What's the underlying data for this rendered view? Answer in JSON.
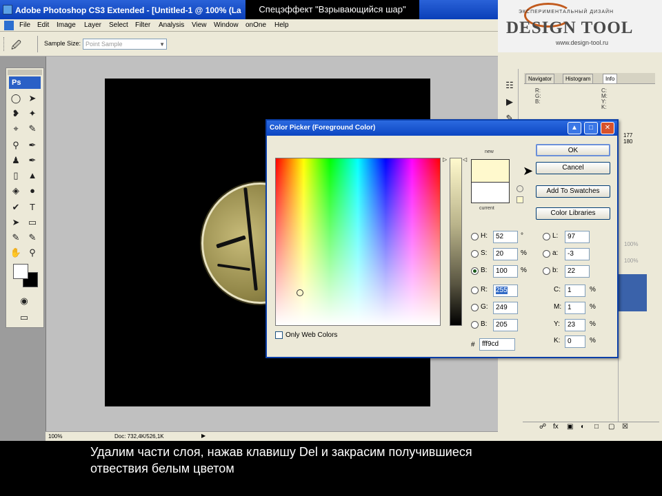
{
  "window": {
    "title": "Adobe Photoshop CS3 Extended - [Untitled-1 @ 100% (La",
    "banner": "Спецэффект \"Взрывающийся шар\""
  },
  "logo": {
    "tagline": "ЭКСПЕРИМЕНТАЛЬНЫЙ ДИЗАЙН",
    "brand": "DESIGN TOOL",
    "url": "www.design-tool.ru"
  },
  "menu": {
    "items": [
      "File",
      "Edit",
      "Image",
      "Layer",
      "Select",
      "Filter",
      "Analysis",
      "View",
      "Window",
      "onOne",
      "Help"
    ]
  },
  "options": {
    "sample_size_label": "Sample Size:",
    "sample_size_value": "Point Sample"
  },
  "toolbox": {
    "logo": "Ps"
  },
  "panels": {
    "tabs": [
      "Navigator",
      "Histogram",
      "Info"
    ],
    "info_left": [
      "R:",
      "G:",
      "B:"
    ],
    "info_right": [
      "C:",
      "M:",
      "Y:",
      "K:"
    ],
    "info_values": [
      "177",
      "180"
    ],
    "opacity_1": "100%",
    "opacity_2": "100%"
  },
  "status": {
    "zoom": "100%",
    "doc": "Doc: 732,4K/526,1K"
  },
  "dialog": {
    "title": "Color Picker (Foreground Color)",
    "new_label": "new",
    "current_label": "current",
    "buttons": {
      "ok": "OK",
      "cancel": "Cancel",
      "add_swatches": "Add To Swatches",
      "libraries": "Color Libraries"
    },
    "hsb": {
      "h": {
        "label": "H:",
        "value": "52",
        "unit": "°"
      },
      "s": {
        "label": "S:",
        "value": "20",
        "unit": "%"
      },
      "b": {
        "label": "B:",
        "value": "100",
        "unit": "%"
      }
    },
    "rgb": {
      "r": {
        "label": "R:",
        "value": "255"
      },
      "g": {
        "label": "G:",
        "value": "249"
      },
      "b": {
        "label": "B:",
        "value": "205"
      }
    },
    "lab": {
      "l": {
        "label": "L:",
        "value": "97"
      },
      "a": {
        "label": "a:",
        "value": "-3"
      },
      "b": {
        "label": "b:",
        "value": "22"
      }
    },
    "cmyk": {
      "c": {
        "label": "C:",
        "value": "1",
        "unit": "%"
      },
      "m": {
        "label": "M:",
        "value": "1",
        "unit": "%"
      },
      "y": {
        "label": "Y:",
        "value": "23",
        "unit": "%"
      },
      "k": {
        "label": "K:",
        "value": "0",
        "unit": "%"
      }
    },
    "only_web_colors": "Only Web Colors",
    "hex": "fff9cd",
    "new_color": "#fff9cd",
    "current_color": "#ffffff"
  },
  "subtitle": {
    "line1": "Удалим части слоя, нажав клавишу Del и закрасим получившиеся",
    "line2": "отвествия белым цветом"
  },
  "colors": {
    "titlebar": "#0a3fb8",
    "chrome": "#ece9d8",
    "canvas": "#000000",
    "sphere": "#8f8446"
  }
}
